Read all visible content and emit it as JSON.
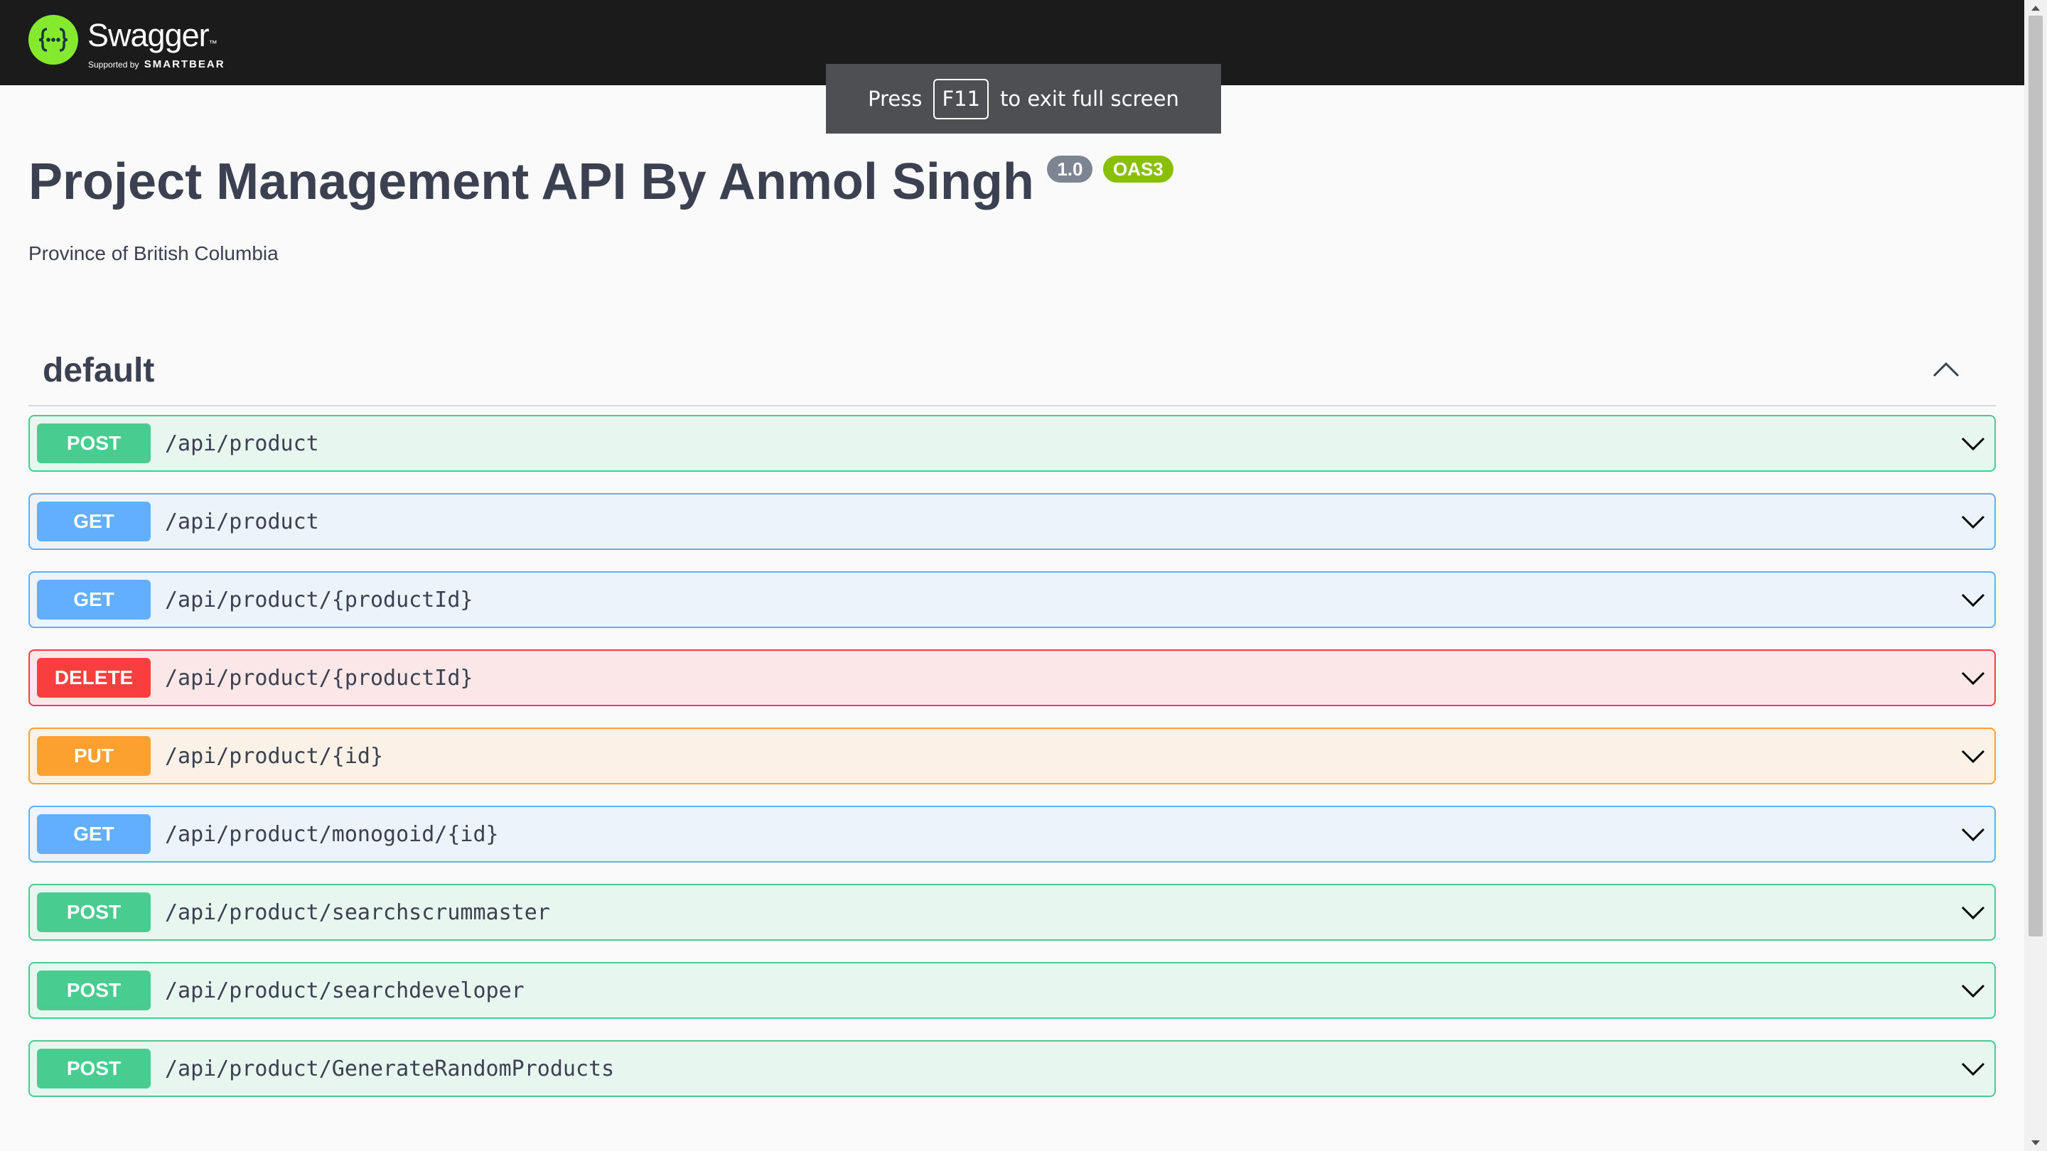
{
  "topbar": {
    "brand": "Swagger",
    "brand_mark": "™",
    "supported_prefix": "Supported by",
    "supported_brand": "SMARTBEAR",
    "colors": {
      "background": "#1b1b1b",
      "logo": "#85ea2d"
    }
  },
  "fullscreen_notice": {
    "prefix": "Press",
    "key": "F11",
    "suffix": "to exit full screen"
  },
  "info": {
    "title": "Project Management API By Anmol Singh",
    "version": "1.0",
    "spec": "OAS3",
    "description": "Province of British Columbia"
  },
  "tag": {
    "name": "default",
    "toggle_icon": "chevron-up-icon"
  },
  "operations": [
    {
      "method": "POST",
      "path": "/api/product"
    },
    {
      "method": "GET",
      "path": "/api/product"
    },
    {
      "method": "GET",
      "path": "/api/product/{productId}"
    },
    {
      "method": "DELETE",
      "path": "/api/product/{productId}"
    },
    {
      "method": "PUT",
      "path": "/api/product/{id}"
    },
    {
      "method": "GET",
      "path": "/api/product/monogoid/{id}"
    },
    {
      "method": "POST",
      "path": "/api/product/searchscrummaster"
    },
    {
      "method": "POST",
      "path": "/api/product/searchdeveloper"
    },
    {
      "method": "POST",
      "path": "/api/product/GenerateRandomProducts"
    }
  ],
  "method_colors": {
    "POST": "#49cc90",
    "GET": "#61affe",
    "DELETE": "#f93e3e",
    "PUT": "#fca130"
  },
  "scrollbar": {
    "position_fraction": 0.0,
    "visible_fraction": 0.8
  }
}
